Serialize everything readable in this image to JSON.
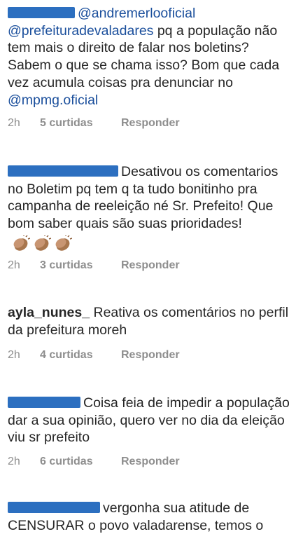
{
  "comments": [
    {
      "mention_before": "@andremerlooficial",
      "text_prefix": "@prefeituradevaladares",
      "text_1": " pq a população não tem mais o direito de falar nos boletins? Sabem o que se chama isso? Bom que cada vez acumula coisas pra denunciar no ",
      "mention_after": "@mpmg.oficial",
      "time": "2h",
      "likes": "5 curtidas",
      "reply": "Responder"
    },
    {
      "text": "Desativou os comentarios no Boletim pq tem q ta tudo bonitinho pra campanha de reeleição né Sr. Prefeito! Que bom saber quais são suas prioridades!",
      "emoji_icon": "clapping-hands-icon",
      "time": "2h",
      "likes": "3 curtidas",
      "reply": "Responder"
    },
    {
      "username": "ayla_nunes_",
      "text": "Reativa os comentários no perfil da prefeitura moreh",
      "time": "2h",
      "likes": "4 curtidas",
      "reply": "Responder"
    },
    {
      "text": "Coisa feia de impedir a população dar a sua opinião, quero ver no dia da eleição viu sr prefeito",
      "time": "2h",
      "likes": "6 curtidas",
      "reply": "Responder"
    },
    {
      "text": "vergonha sua atitude de CENSURAR o povo valadarense, temos o"
    }
  ],
  "colors": {
    "text": "#262626",
    "meta": "#8e8e8e",
    "mention": "#1b4f9c",
    "censor_overlay": "#2c6fc0",
    "background": "#ffffff"
  }
}
